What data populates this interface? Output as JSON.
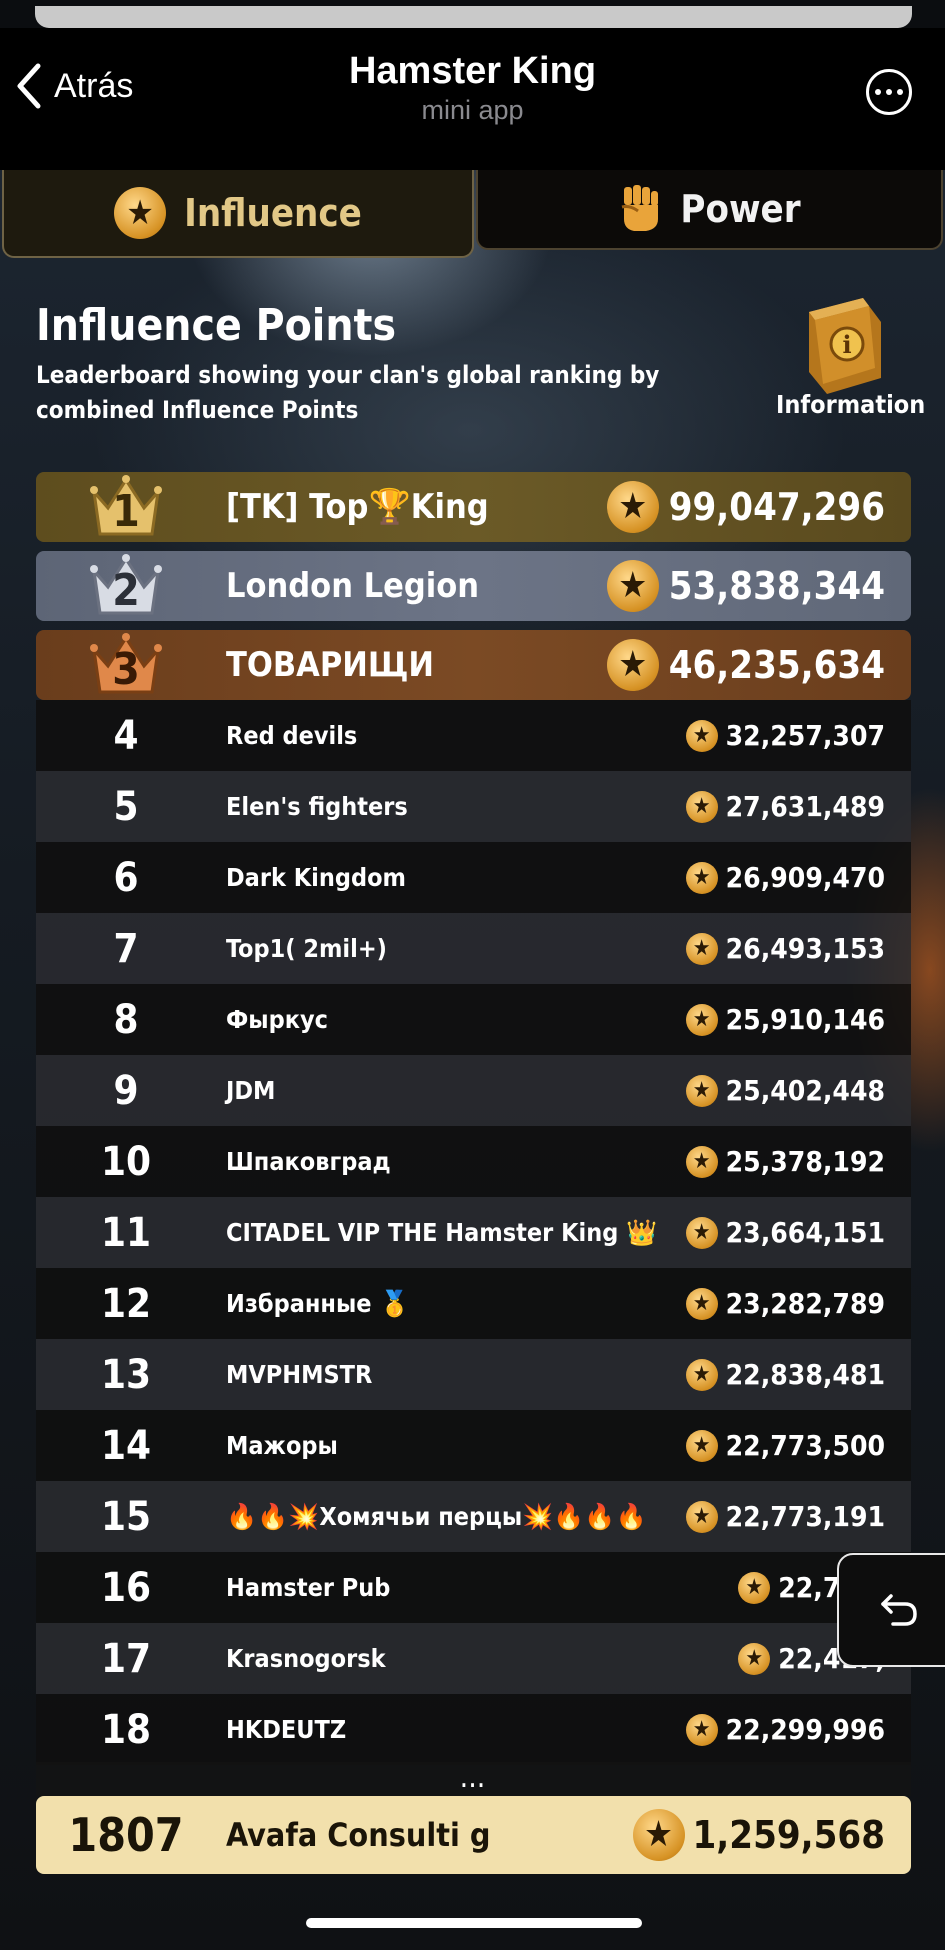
{
  "header": {
    "back_label": "Atrás",
    "title": "Hamster King",
    "subtitle": "mini app"
  },
  "tabs": [
    {
      "label": "Influence",
      "icon": "star-icon",
      "active": true
    },
    {
      "label": "Power",
      "icon": "fist-icon",
      "active": false
    }
  ],
  "section": {
    "title": "Influence Points",
    "description": "Leaderboard showing your clan's global ranking by combined Influence Points",
    "info_label": "Information"
  },
  "leaderboard": [
    {
      "rank": "1",
      "name": "[TK] Top🏆King",
      "score": "99,047,296"
    },
    {
      "rank": "2",
      "name": "London Legion",
      "score": "53,838,344"
    },
    {
      "rank": "3",
      "name": "ТОВАРИЩИ",
      "score": "46,235,634"
    },
    {
      "rank": "4",
      "name": "Red devils",
      "score": "32,257,307"
    },
    {
      "rank": "5",
      "name": "Elen's fighters",
      "score": "27,631,489"
    },
    {
      "rank": "6",
      "name": "Dark Kingdom",
      "score": "26,909,470"
    },
    {
      "rank": "7",
      "name": "Top1( 2mil+)",
      "score": "26,493,153"
    },
    {
      "rank": "8",
      "name": "Фыркус",
      "score": "25,910,146"
    },
    {
      "rank": "9",
      "name": "JDM",
      "score": "25,402,448"
    },
    {
      "rank": "10",
      "name": "Шпаковград",
      "score": "25,378,192"
    },
    {
      "rank": "11",
      "name": "CITADEL VIP THE Hamster King 👑",
      "score": "23,664,151"
    },
    {
      "rank": "12",
      "name": "Избранные 🥇",
      "score": "23,282,789"
    },
    {
      "rank": "13",
      "name": "MVPHMSTR",
      "score": "22,838,481"
    },
    {
      "rank": "14",
      "name": "Мажоры",
      "score": "22,773,500"
    },
    {
      "rank": "15",
      "name": "🔥🔥💥Хомячьи перцы💥🔥🔥🔥",
      "score": "22,773,191"
    },
    {
      "rank": "16",
      "name": "Hamster Pub",
      "score": "22,718,"
    },
    {
      "rank": "17",
      "name": "Krasnogorsk",
      "score": "22,417,"
    },
    {
      "rank": "18",
      "name": "HKDEUTZ",
      "score": "22,299,996"
    }
  ],
  "ellipsis": "...",
  "my_clan": {
    "rank": "1807",
    "name": "Avafa Consulti g",
    "score": "1,259,568"
  },
  "colors": {
    "gold_row": "#6b5a27",
    "silver_row": "#6c7486",
    "bronze_row": "#7b4a24",
    "my_clan_row": "#f2e0ac",
    "tab_active_text": "#e2c887"
  }
}
